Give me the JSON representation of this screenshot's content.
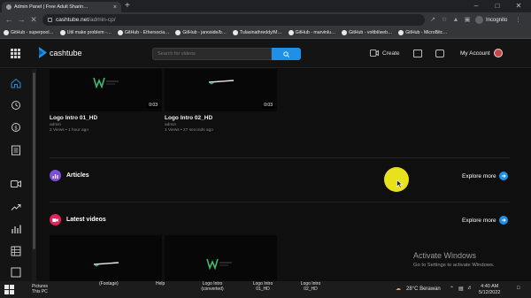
{
  "browser": {
    "tab_title": "Admin Panel | Free Adult Sharin…",
    "tab_close": "×",
    "new_tab": "+",
    "url_host": "cashtube.net",
    "url_path": "/admin-cp/",
    "incognito_label": "Incognito",
    "bookmarks": [
      "GitHub - superpool…",
      "Util make problem -…",
      "GitHub - Ethersocia…",
      "GitHub - janoside/b…",
      "Tulasinathreddy/M…",
      "GitHub - marvinlu…",
      "GitHub - voltbl/web…",
      "GitHub - MicroBitc…"
    ]
  },
  "header": {
    "logo_text": "cashtube",
    "search_placeholder": "Search for videos",
    "create_label": "Create",
    "account_label": "My Account"
  },
  "top_videos": [
    {
      "title": "Logo Intro 01_HD",
      "author": "admin",
      "meta": "2 Views • 1 hour ago",
      "duration": "0:03"
    },
    {
      "title": "Logo Intro 02_HD",
      "author": "admin",
      "meta": "1 Views • 27 seconds ago",
      "duration": "0:03"
    }
  ],
  "sections": {
    "articles_title": "Articles",
    "latest_title": "Latest videos",
    "explore_label": "Explore more"
  },
  "watermark": {
    "title": "Activate Windows",
    "subtitle": "Go to Settings to activate Windows."
  },
  "taskbar": {
    "items": [
      "Pictures",
      "This PC",
      "(Footage)",
      "Help",
      "Logo Intro (converted)",
      "Logo Intro 01_HD",
      "Logo Intro 02_HD"
    ],
    "weather": "28°C Berawan",
    "time": "4:40 AM",
    "date": "5/12/2022"
  },
  "colors": {
    "accent": "#1e90e6",
    "articles_icon": "#7b4fd6",
    "latest_icon": "#e0245e",
    "cursor_highlight": "#e8e21c"
  }
}
